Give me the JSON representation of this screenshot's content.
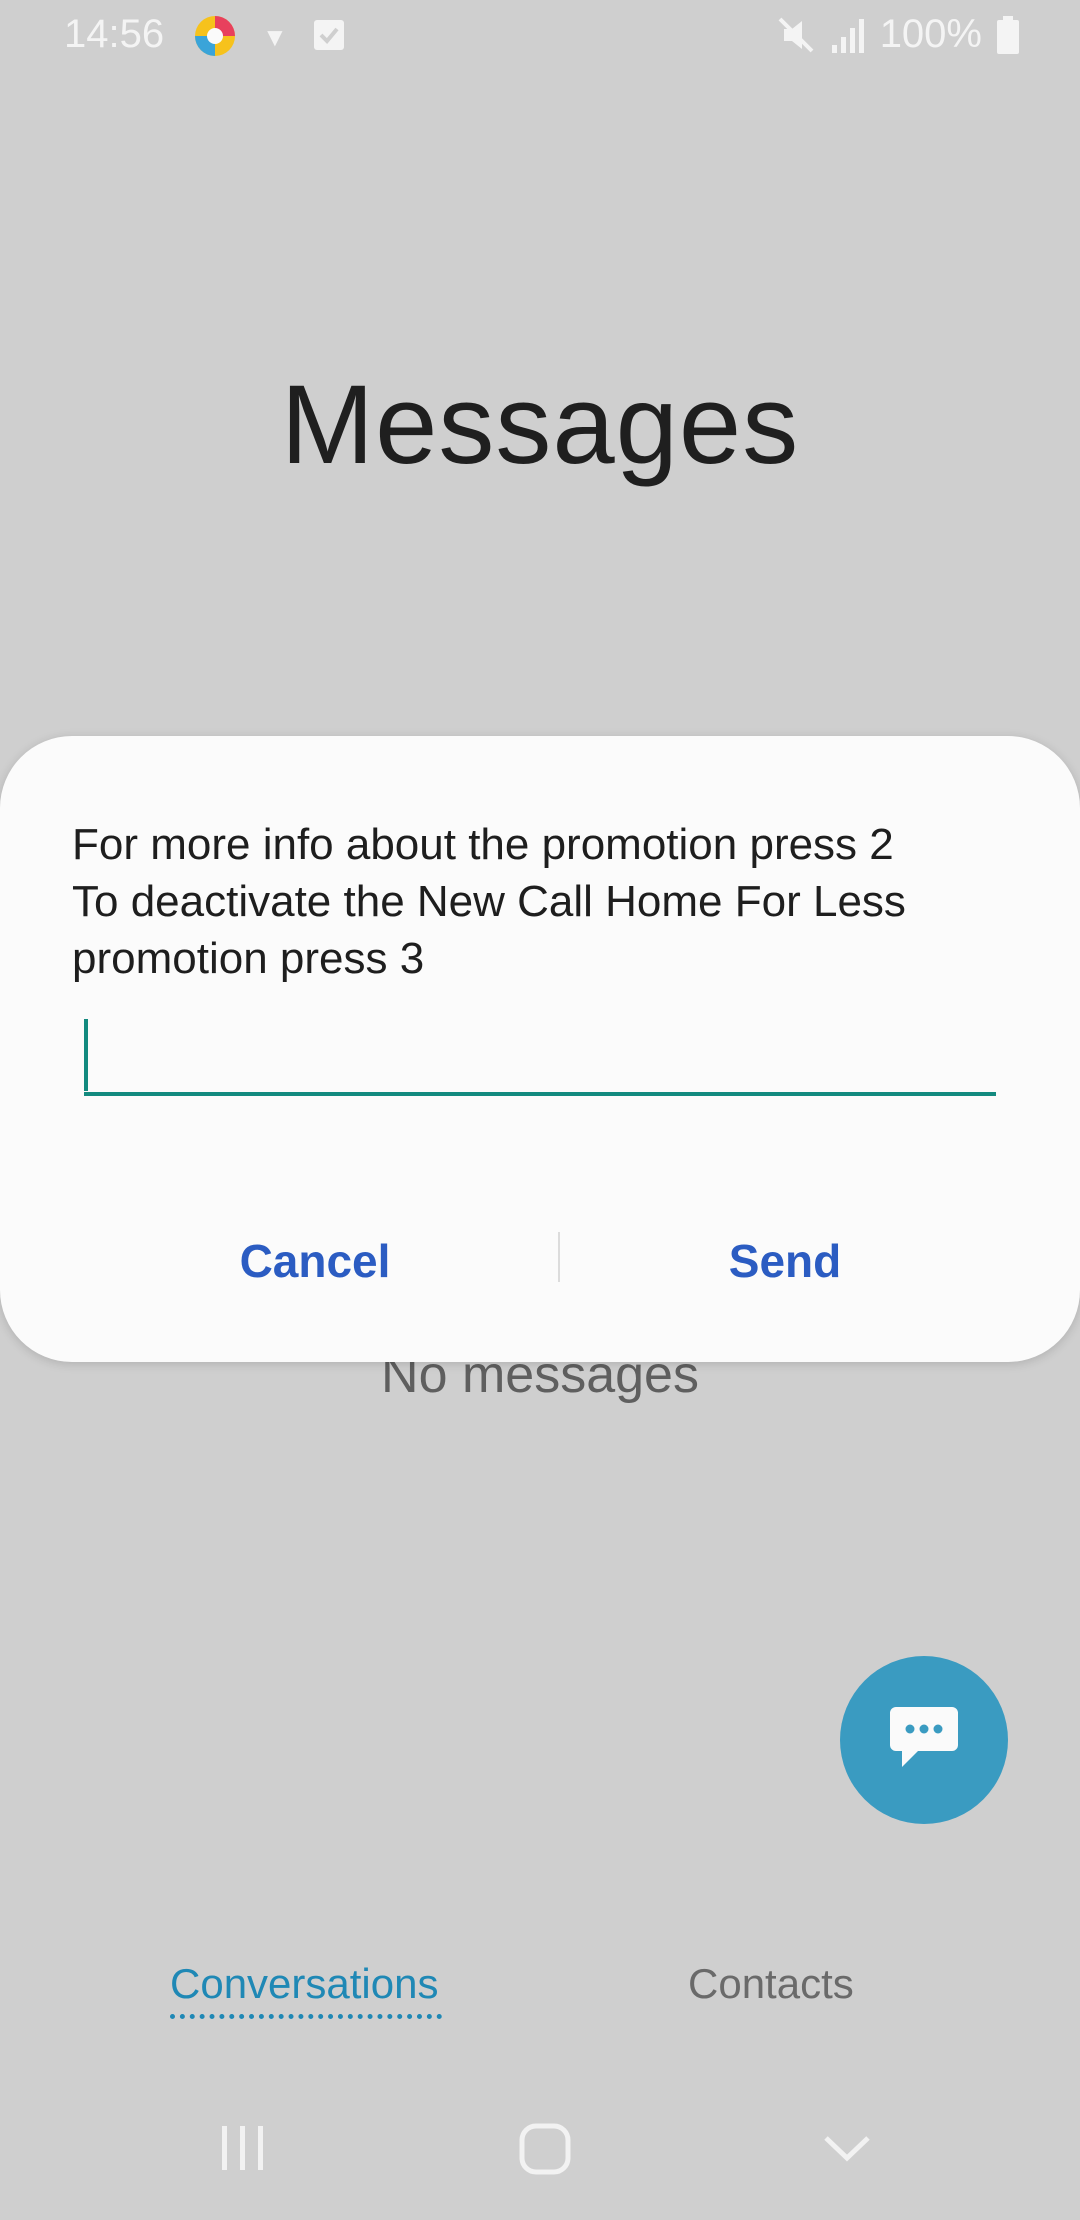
{
  "status_bar": {
    "time": "14:56",
    "battery": "100%",
    "icons": [
      "app-icon",
      "caret-down-icon",
      "checkbox-icon",
      "mute-icon",
      "signal-icon",
      "battery-icon"
    ]
  },
  "app": {
    "title": "Messages",
    "empty_state": "No messages"
  },
  "dialog": {
    "message": "For more info about the promotion press 2\nTo deactivate the New Call Home For Less\npromotion press 3",
    "input_value": "",
    "input_placeholder": "",
    "cancel_label": "Cancel",
    "send_label": "Send"
  },
  "tabs": [
    {
      "label": "Conversations",
      "active": true
    },
    {
      "label": "Contacts",
      "active": false
    }
  ],
  "colors": {
    "accent": "#1f88b5",
    "fab": "#3a9bc1",
    "dialog_button": "#2b5cc2",
    "input_underline": "#138a7f",
    "background": "#cfcfcf"
  }
}
